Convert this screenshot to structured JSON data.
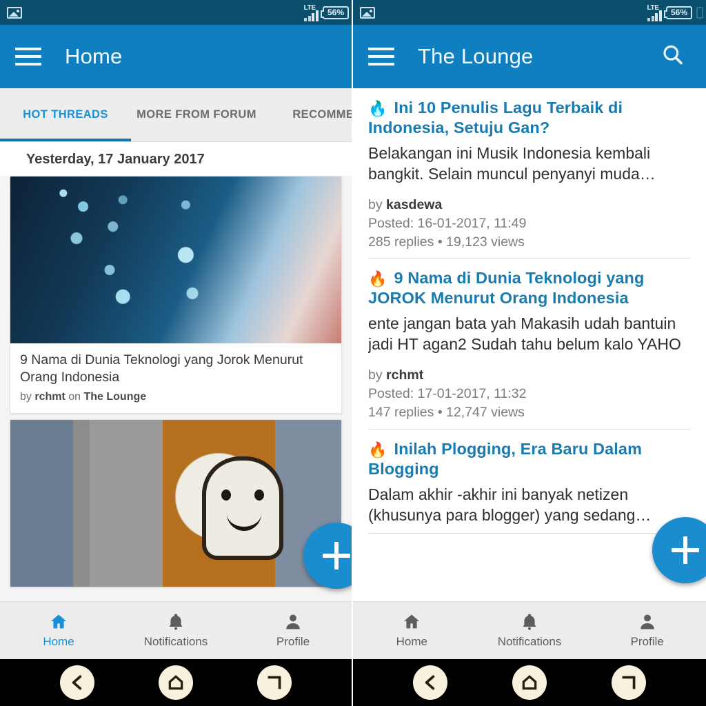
{
  "status_bar": {
    "image_icon": "image-icon",
    "network_label": "LTE",
    "battery_percent": "56%"
  },
  "left_phone": {
    "appbar": {
      "menu_icon": "hamburger-menu-icon",
      "title": "Home"
    },
    "tabs": [
      {
        "label": "HOT THREADS",
        "active": true
      },
      {
        "label": "MORE FROM FORUM",
        "active": false
      },
      {
        "label": "RECOMMEN",
        "active": false
      }
    ],
    "day_label": "Yesterday, 17 January 2017",
    "cards": [
      {
        "image": "technology-network-image",
        "title": "9 Nama di Dunia Teknologi yang Jorok Menurut Orang Indonesia",
        "meta_prefix": "by ",
        "author": "rchmt",
        "meta_middle": " on ",
        "forum": "The Lounge"
      },
      {
        "image": "snapchat-ghost-photo",
        "title": "",
        "meta_prefix": "",
        "author": "",
        "meta_middle": "",
        "forum": ""
      }
    ],
    "fab": {
      "icon": "plus-icon",
      "label": "+"
    },
    "bottom_nav": [
      {
        "label": "Home",
        "icon": "home-icon",
        "active": true
      },
      {
        "label": "Notifications",
        "icon": "bell-icon",
        "active": false
      },
      {
        "label": "Profile",
        "icon": "person-icon",
        "active": false
      }
    ]
  },
  "right_phone": {
    "appbar": {
      "menu_icon": "hamburger-menu-icon",
      "title": "The Lounge",
      "search_icon": "search-icon"
    },
    "threads": [
      {
        "flame": "🔥",
        "flame_color": "blue",
        "title": "Ini 10 Penulis Lagu Terbaik di Indonesia, Setuju Gan?",
        "excerpt_line1": "Belakangan ini Musik Indonesia kembali",
        "excerpt_line2": "bangkit. Selain muncul penyanyi muda…",
        "by_prefix": "by ",
        "author": "kasdewa",
        "posted": "Posted: 16-01-2017, 11:49",
        "stats": "285 replies • 19,123 views"
      },
      {
        "flame": "🔥",
        "flame_color": "orange",
        "title": "9 Nama di Dunia Teknologi yang JOROK Menurut Orang Indonesia",
        "excerpt_line1": "ente jangan bata yah Makasih udah bantuin",
        "excerpt_line2": "jadi HT agan2 Sudah tahu belum kalo YAHO",
        "by_prefix": "by ",
        "author": "rchmt",
        "posted": "Posted: 17-01-2017, 11:32",
        "stats": "147 replies • 12,747 views"
      },
      {
        "flame": "🔥",
        "flame_color": "orange",
        "title": "Inilah Plogging, Era Baru Dalam Blogging",
        "excerpt_line1": "Dalam akhir -akhir ini banyak netizen",
        "excerpt_line2": "(khusunya para blogger) yang sedang…",
        "by_prefix": "",
        "author": "",
        "posted": "",
        "stats": ""
      }
    ],
    "fab": {
      "icon": "plus-icon",
      "label": "+"
    },
    "bottom_nav": [
      {
        "label": "Home",
        "icon": "home-icon",
        "active": false
      },
      {
        "label": "Notifications",
        "icon": "bell-icon",
        "active": false
      },
      {
        "label": "Profile",
        "icon": "person-icon",
        "active": false
      }
    ]
  },
  "system_bar": {
    "back_icon": "back-arrow-icon",
    "home_icon": "home-pentagon-icon",
    "recents_icon": "recents-icon"
  },
  "colors": {
    "status_bar": "#0b4f6c",
    "app_bar": "#0f7fc0",
    "accent": "#1a8fd6",
    "link": "#1a7bb0",
    "fab": "#1b8ccd",
    "tab_indicator": "#1573ad"
  }
}
